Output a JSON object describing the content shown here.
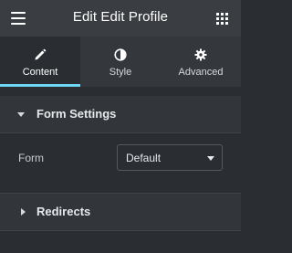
{
  "header": {
    "title": "Edit Edit Profile",
    "menu_icon": "hamburger-menu-icon",
    "apps_icon": "grid-apps-icon"
  },
  "tabs": [
    {
      "label": "Content",
      "icon": "pencil-icon",
      "active": true
    },
    {
      "label": "Style",
      "icon": "half-circle-icon",
      "active": false
    },
    {
      "label": "Advanced",
      "icon": "gear-icon",
      "active": false
    }
  ],
  "sections": {
    "form_settings": {
      "title": "Form Settings",
      "expanded": true,
      "form_label": "Form",
      "form_value": "Default"
    },
    "redirects": {
      "title": "Redirects",
      "expanded": false
    }
  },
  "colors": {
    "accent": "#71d7f7",
    "background": "#2a2e33",
    "topbar": "#3a3e43"
  }
}
